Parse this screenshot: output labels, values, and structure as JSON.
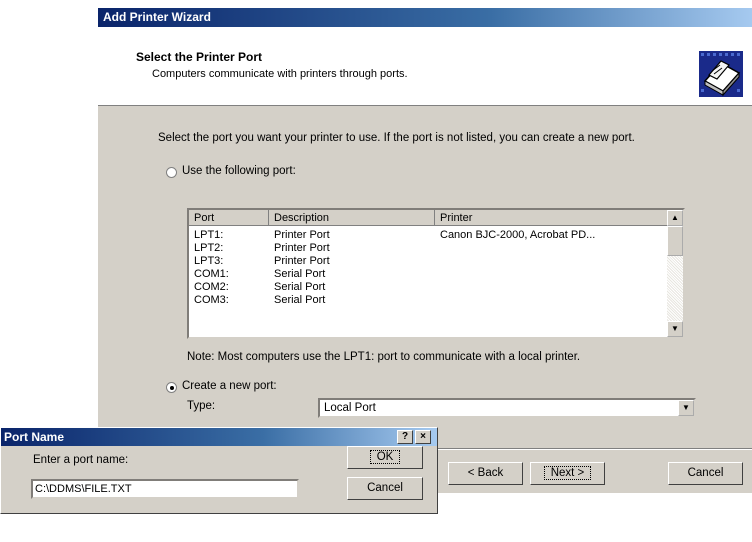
{
  "wizard": {
    "title": "Add Printer Wizard",
    "header_title": "Select the Printer Port",
    "header_subtitle": "Computers communicate with printers through ports.",
    "header_icon": "printer-icon",
    "instruction": "Select the port you want your printer to use.  If the port is not listed, you can create a new port.",
    "use_port_label": "Use the following port:",
    "use_port_selected": false,
    "ports": {
      "columns": [
        "Port",
        "Description",
        "Printer"
      ],
      "rows": [
        {
          "port": "LPT1:",
          "description": "Printer Port",
          "printer": "Canon BJC-2000, Acrobat PD..."
        },
        {
          "port": "LPT2:",
          "description": "Printer Port",
          "printer": ""
        },
        {
          "port": "LPT3:",
          "description": "Printer Port",
          "printer": ""
        },
        {
          "port": "COM1:",
          "description": "Serial Port",
          "printer": ""
        },
        {
          "port": "COM2:",
          "description": "Serial Port",
          "printer": ""
        },
        {
          "port": "COM3:",
          "description": "Serial Port",
          "printer": ""
        }
      ]
    },
    "note": "Note: Most computers use the LPT1: port to communicate with a local printer.",
    "create_port_label": "Create a new port:",
    "create_port_selected": true,
    "type_label": "Type:",
    "type_value": "Local Port",
    "buttons": {
      "back": "< Back",
      "next": "Next >",
      "cancel": "Cancel"
    }
  },
  "port_dialog": {
    "title": "Port Name",
    "help_glyph": "?",
    "close_glyph": "×",
    "prompt": "Enter a port name:",
    "value": "C:\\DDMS\\FILE.TXT",
    "ok": "OK",
    "cancel": "Cancel"
  }
}
